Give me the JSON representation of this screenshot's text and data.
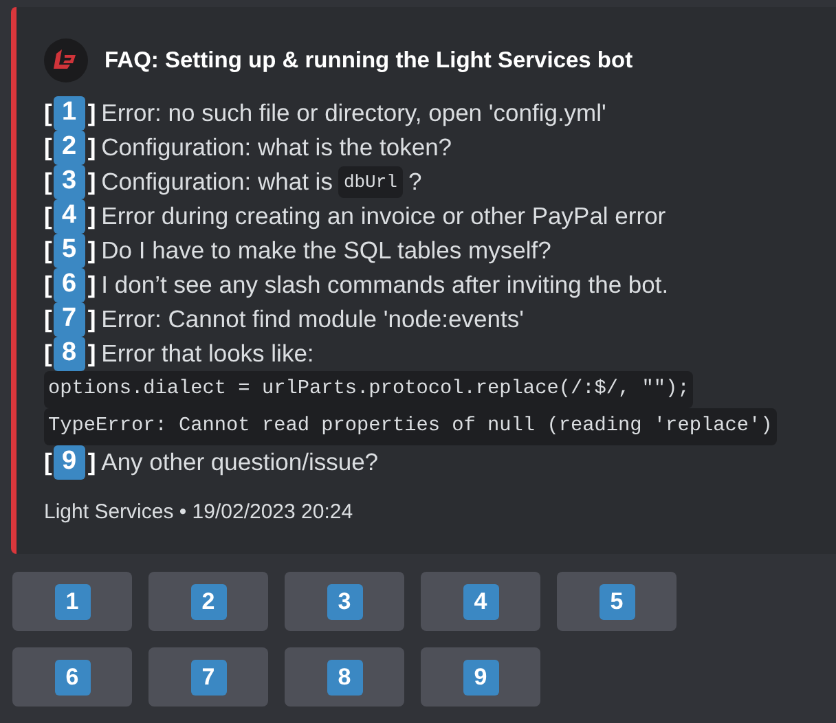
{
  "embed": {
    "title": "FAQ: Setting up & running the Light Services bot",
    "lines": [
      {
        "kind": "item",
        "open": "[",
        "close": "]",
        "number": "1",
        "parts": [
          {
            "kind": "text",
            "text": "Error: no such file or directory, open 'config.yml'"
          }
        ]
      },
      {
        "kind": "item",
        "open": "[",
        "close": "]",
        "number": "2",
        "parts": [
          {
            "kind": "text",
            "text": "Configuration: what is the token?"
          }
        ]
      },
      {
        "kind": "item",
        "open": "[",
        "close": "]",
        "number": "3",
        "parts": [
          {
            "kind": "text",
            "text": "Configuration: what is"
          },
          {
            "kind": "code",
            "text": "dbUrl"
          },
          {
            "kind": "text",
            "text": "?"
          }
        ]
      },
      {
        "kind": "item",
        "open": "[",
        "close": "]",
        "number": "4",
        "parts": [
          {
            "kind": "text",
            "text": "Error during creating an invoice or other PayPal error"
          }
        ]
      },
      {
        "kind": "item",
        "open": "[",
        "close": "]",
        "number": "5",
        "parts": [
          {
            "kind": "text",
            "text": "Do I have to make the SQL tables myself?"
          }
        ]
      },
      {
        "kind": "item",
        "open": "[",
        "close": "]",
        "number": "6",
        "parts": [
          {
            "kind": "text",
            "text": "I don’t see any slash commands after inviting the bot."
          }
        ]
      },
      {
        "kind": "item",
        "open": "[",
        "close": "]",
        "number": "7",
        "parts": [
          {
            "kind": "text",
            "text": "Error: Cannot find module 'node:events'"
          }
        ]
      },
      {
        "kind": "item",
        "open": "[",
        "close": "]",
        "number": "8",
        "parts": [
          {
            "kind": "text",
            "text": "Error that looks like:"
          }
        ]
      },
      {
        "kind": "code",
        "text": "options.dialect = urlParts.protocol.replace(/:$/, \"\");"
      },
      {
        "kind": "code",
        "text": "TypeError: Cannot read properties of null (reading 'replace')"
      },
      {
        "kind": "item",
        "open": "[",
        "close": "]",
        "number": "9",
        "parts": [
          {
            "kind": "text",
            "text": "Any other question/issue?"
          }
        ]
      }
    ],
    "footer": "Light Services • 19/02/2023 20:24"
  },
  "buttons": [
    "1",
    "2",
    "3",
    "4",
    "5",
    "6",
    "7",
    "8",
    "9"
  ]
}
